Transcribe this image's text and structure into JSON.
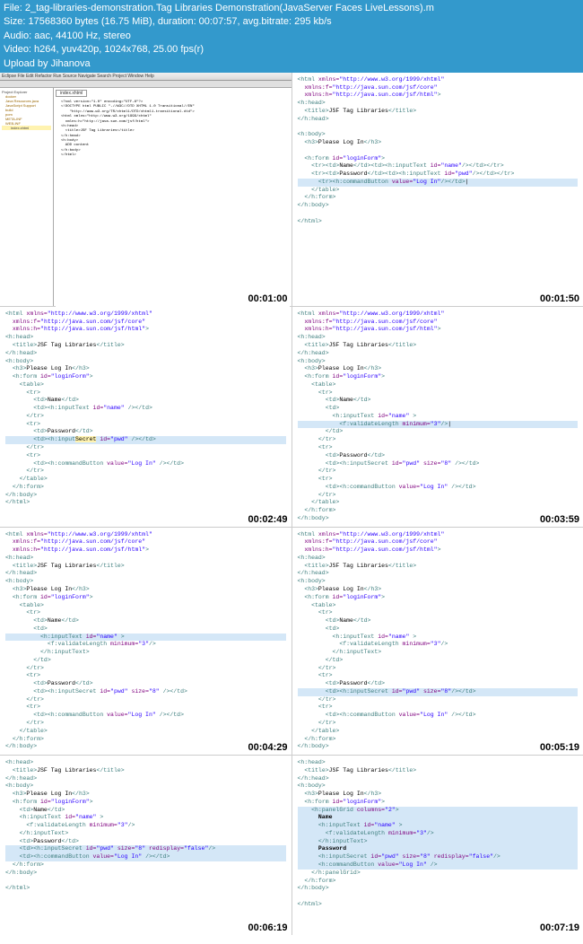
{
  "header": {
    "file": "File: 2_tag-libraries-demonstration.Tag Libraries Demonstration(JavaServer Faces LiveLessons).m",
    "size": "Size: 17568360 bytes (16.75 MiB), duration: 00:07:57, avg.bitrate: 295 kb/s",
    "audio": "Audio: aac, 44100 Hz, stereo",
    "video": "Video: h264, yuv420p, 1024x768, 25.00 fps(r)",
    "upload": "Upload by Jihanova"
  },
  "eclipse": {
    "menubar": "Eclipse  File  Edit  Refactor  Run  Source  Navigate  Search  Project  Window  Help",
    "sidebar": {
      "title": "Project Explorer",
      "items": [
        "docker",
        "Java Resources java",
        "JavaScript Support",
        "build",
        "pom",
        "META-INF",
        "WEB-INF",
        "index.xhtml"
      ]
    },
    "tab": "index.xhtml"
  },
  "timestamps": [
    "00:01:00",
    "00:01:50",
    "00:02:49",
    "00:03:59",
    "00:04:29",
    "00:05:19",
    "00:06:19",
    "00:07:19"
  ],
  "code_common": {
    "xmlns": "http://www.w3.org/1999/xhtml",
    "xmlns_f": "http://java.sun.com/jsf/core",
    "xmlns_h": "http://java.sun.com/jsf/html",
    "title": "JSF Tag Libraries",
    "h3": "Please Log In",
    "form_id": "loginForm",
    "name_label": "Name",
    "password_label": "Password",
    "login_value": "Log In",
    "name_id": "name",
    "pwd_id": "pwd",
    "min_len": "3",
    "size_8": "8",
    "redisplay": "false",
    "columns": "2"
  },
  "frame1_editor": "<?xml version=\"1.0\" encoding=\"UTF-8\"?>\n<!DOCTYPE html PUBLIC \"-//W3C//DTD XHTML 1.0 Transitional//EN\"\n    \"http://www.w3.org/TR/xhtml1/DTD/xhtml1-transitional.dtd\">\n<html xmlns=\"http://www.w3.org/1999/xhtml\"\n  xmlns:h=\"http://java.sun.com/jsf/html\">\n<h:head>\n  <title>JSF Tag Libraries</title>\n</h:head>\n<h:body>\n  ADD content\n</h:body>\n</html>"
}
